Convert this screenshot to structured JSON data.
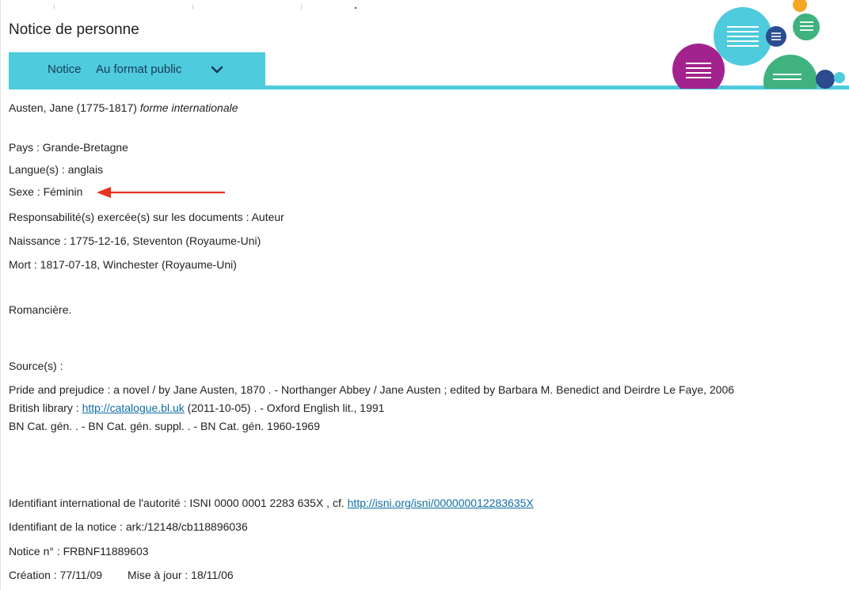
{
  "page": {
    "title": "Notice de personne"
  },
  "tabs": {
    "notice_label": "Notice",
    "format_label": "Au format public"
  },
  "colors": {
    "accent": "#4ecbdd",
    "link": "#0e6ea3",
    "annotation_arrow": "#e8321e",
    "bubble_teal": "#4ecbdd",
    "bubble_green": "#3fb27f",
    "bubble_purple": "#a3238e",
    "bubble_navy": "#2b4c8f",
    "bubble_orange": "#f5a623"
  },
  "record": {
    "heading_name": "Austen, Jane (1775-1817)",
    "heading_form": "forme internationale",
    "pays": "Pays : Grande-Bretagne",
    "langue": "Langue(s) : anglais",
    "sexe": "Sexe : Féminin",
    "responsabilite": "Responsabilité(s) exercée(s) sur les documents : Auteur",
    "naissance": "Naissance : 1775-12-16, Steventon (Royaume-Uni)",
    "mort": "Mort : 1817-07-18, Winchester (Royaume-Uni)",
    "note": "Romancière.",
    "sources_label": "Source(s) :",
    "source_line1": "Pride and prejudice : a novel / by Jane Austen, 1870 . - Northanger Abbey / Jane Austen ; edited by Barbara M. Benedict and Deirdre Le Faye, 2006",
    "source_line2_prefix": "British library : ",
    "source_line2_link": "http://catalogue.bl.uk",
    "source_line2_suffix": " (2011-10-05) . - Oxford English lit., 1991",
    "source_line3": "BN Cat. gén. . - BN Cat. gén. suppl. . - BN Cat. gén. 1960-1969",
    "isni_prefix": "Identifiant international de l'autorité :  ISNI 0000 0001 2283 635X , cf. ",
    "isni_link": "http://isni.org/isni/000000012283635X",
    "identifiant": "Identifiant de la notice  : ark:/12148/cb118896036",
    "notice_no": "Notice n° : FRBNF11889603",
    "creation": "Création : 77/11/09",
    "mise_a_jour": "Mise à jour : 18/11/06"
  },
  "icons": {
    "chevron": "chevron-down-icon",
    "arrow": "left-arrow-annotation",
    "decor": "speech-bubbles-decoration"
  }
}
